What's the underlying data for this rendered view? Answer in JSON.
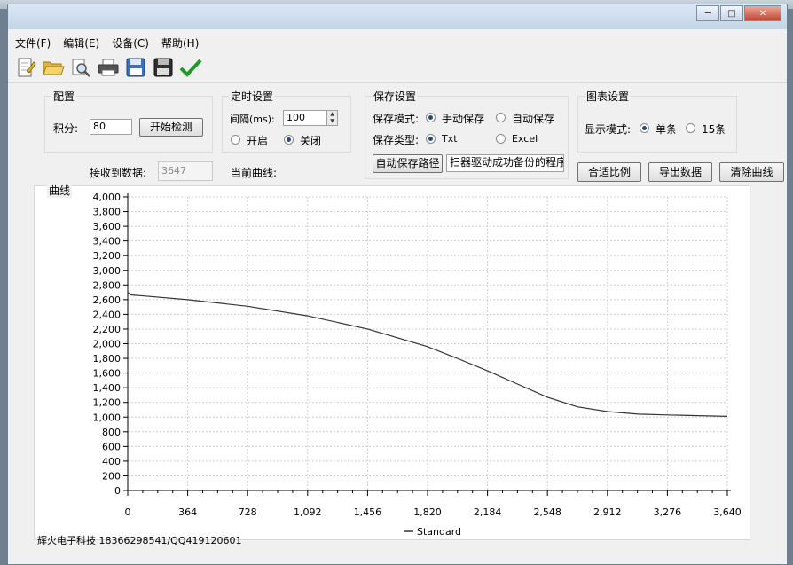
{
  "menu": {
    "file": "文件(F)",
    "edit": "编辑(E)",
    "device": "设备(C)",
    "help": "帮助(H)"
  },
  "toolbar_icons": [
    "new-file-icon",
    "open-folder-icon",
    "print-preview-icon",
    "print-icon",
    "save-icon",
    "save-as-icon",
    "check-icon"
  ],
  "config": {
    "title": "配置",
    "integral_label": "积分:",
    "integral_value": "80",
    "start_button": "开始检测"
  },
  "timer": {
    "title": "定时设置",
    "interval_label": "间隔(ms):",
    "interval_value": "100",
    "on_label": "开启",
    "off_label": "关闭"
  },
  "save": {
    "title": "保存设置",
    "mode_label": "保存模式:",
    "manual_label": "手动保存",
    "auto_label": "自动保存",
    "type_label": "保存类型:",
    "txt_label": "Txt",
    "excel_label": "Excel",
    "path_button": "自动保存路径",
    "path_value": "扫器驱动成功备份的程序"
  },
  "chart_settings": {
    "title": "图表设置",
    "mode_label": "显示模式:",
    "single_label": "单条",
    "fifteen_label": "15条"
  },
  "status": {
    "received_label": "接收到数据:",
    "received_value": "3647",
    "current_curve_label": "当前曲线:"
  },
  "actions": {
    "fit_button": "合适比例",
    "export_button": "导出数据",
    "clear_button": "清除曲线"
  },
  "footer": {
    "text": "辉火电子科技 18366298541/QQ419120601"
  },
  "chart_data": {
    "type": "line",
    "title": "曲线",
    "xlim": [
      0,
      3640
    ],
    "ylim": [
      0,
      4000
    ],
    "x_ticks": [
      0,
      364,
      728,
      1092,
      1456,
      1820,
      2184,
      2548,
      2912,
      3276,
      3640
    ],
    "x_tick_labels": [
      "0",
      "364",
      "728",
      "1,092",
      "1,456",
      "1,820",
      "2,184",
      "2,548",
      "2,912",
      "3,276",
      "3,640"
    ],
    "y_ticks": [
      0,
      200,
      400,
      600,
      800,
      1000,
      1200,
      1400,
      1600,
      1800,
      2000,
      2200,
      2400,
      2600,
      2800,
      3000,
      3200,
      3400,
      3600,
      3800,
      4000
    ],
    "y_tick_labels": [
      "0",
      "200",
      "400",
      "600",
      "800",
      "1,000",
      "1,200",
      "1,400",
      "1,600",
      "1,800",
      "2,000",
      "2,200",
      "2,400",
      "2,600",
      "2,800",
      "3,000",
      "3,200",
      "3,400",
      "3,600",
      "3,800",
      "4,000"
    ],
    "grid": true,
    "legend": "bottom-center",
    "series": [
      {
        "name": "Standard",
        "color": "#333333",
        "x": [
          0,
          20,
          100,
          364,
          728,
          1092,
          1456,
          1820,
          2000,
          2184,
          2366,
          2548,
          2730,
          2912,
          3100,
          3276,
          3460,
          3640
        ],
        "y": [
          2700,
          2665,
          2650,
          2600,
          2510,
          2380,
          2200,
          1960,
          1800,
          1630,
          1450,
          1270,
          1140,
          1075,
          1040,
          1030,
          1020,
          1010
        ]
      }
    ]
  }
}
